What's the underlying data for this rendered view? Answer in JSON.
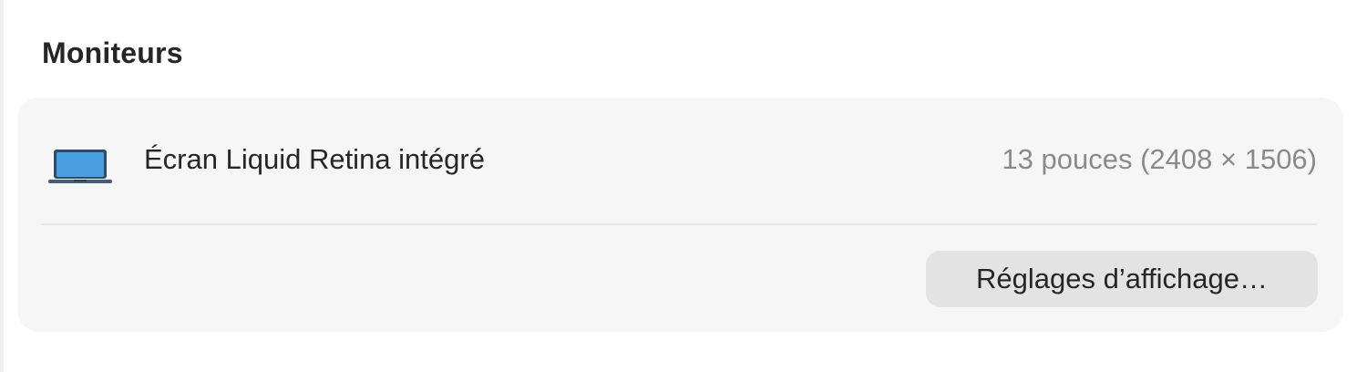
{
  "section": {
    "title": "Moniteurs"
  },
  "monitor": {
    "icon": "laptop-icon",
    "name": "Écran Liquid Retina intégré",
    "spec": "13 pouces (2408 × 1506)"
  },
  "actions": {
    "display_settings_label": "Réglages d’affichage…"
  },
  "colors": {
    "card_background": "#f6f6f6",
    "button_background": "#e3e3e3",
    "text_primary": "#262626",
    "text_secondary": "#8a8a8a",
    "laptop_screen": "#4a9fe3"
  }
}
